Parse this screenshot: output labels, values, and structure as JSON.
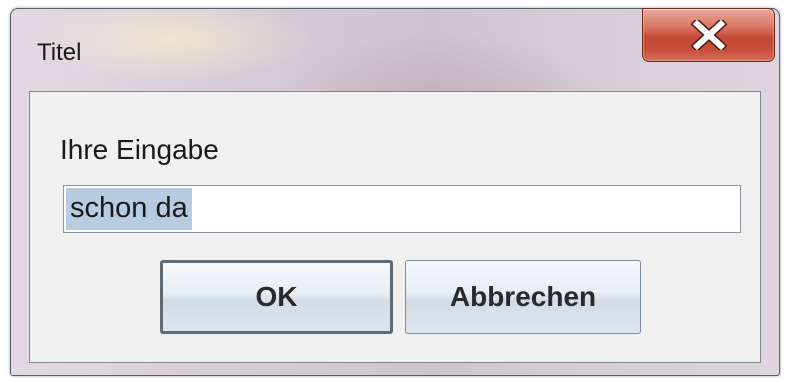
{
  "window": {
    "title": "Titel",
    "close_icon": "close-x-icon"
  },
  "dialog": {
    "prompt_label": "Ihre Eingabe",
    "input_value": "schon da",
    "ok_label": "OK",
    "cancel_label": "Abbrechen"
  },
  "colors": {
    "close_button": "#c24a36",
    "selection": "#b7cbe1",
    "content_background": "#f0f0f0"
  }
}
